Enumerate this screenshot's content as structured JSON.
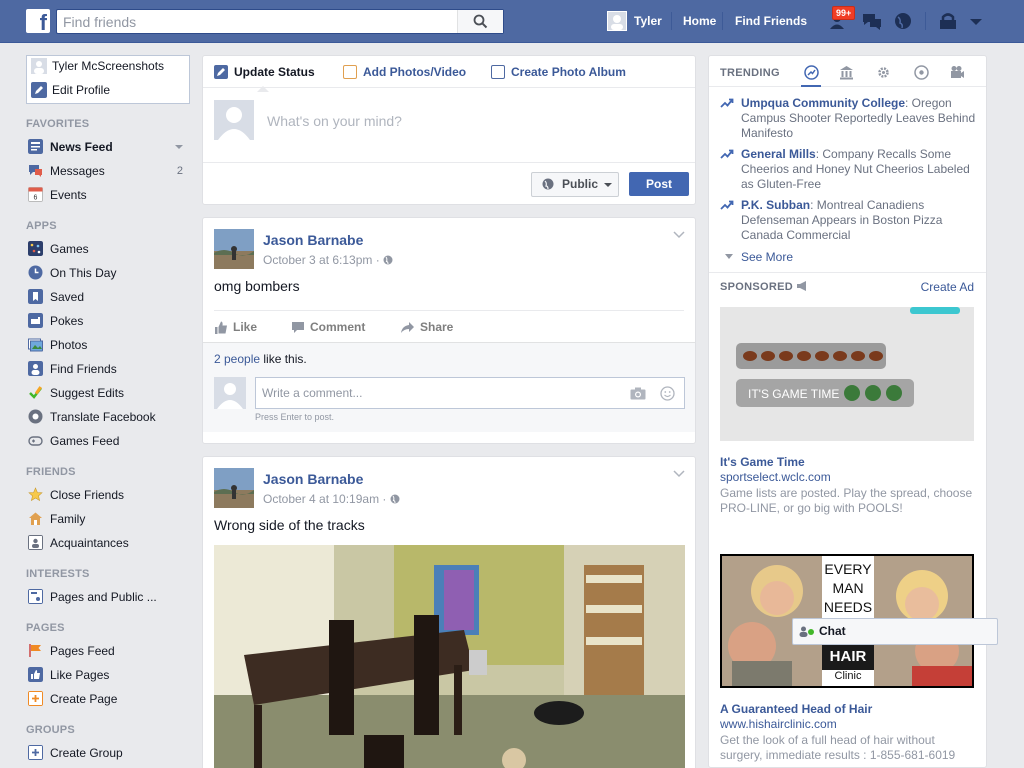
{
  "topbar": {
    "search_placeholder": "Find friends",
    "user_name": "Tyler",
    "home": "Home",
    "find_friends": "Find Friends",
    "notif_count": "99+",
    "brand_color": "#4e69a2"
  },
  "left": {
    "profile_name": "Tyler McScreenshots",
    "edit_profile": "Edit Profile",
    "favorites_title": "FAVORITES",
    "favorites": [
      {
        "label": "News Feed"
      },
      {
        "label": "Messages",
        "count": "2"
      },
      {
        "label": "Events"
      }
    ],
    "apps_title": "APPS",
    "apps": [
      "Games",
      "On This Day",
      "Saved",
      "Pokes",
      "Photos",
      "Find Friends",
      "Suggest Edits",
      "Translate Facebook",
      "Games Feed"
    ],
    "friends_title": "FRIENDS",
    "friends": [
      "Close Friends",
      "Family",
      "Acquaintances"
    ],
    "interests_title": "INTERESTS",
    "interests": [
      "Pages and Public ..."
    ],
    "pages_title": "PAGES",
    "pages": [
      "Pages Feed",
      "Like Pages",
      "Create Page"
    ],
    "groups_title": "GROUPS",
    "groups": [
      "Create Group"
    ]
  },
  "composer": {
    "tab_update": "Update Status",
    "tab_photos": "Add Photos/Video",
    "tab_album": "Create Photo Album",
    "placeholder": "What's on your mind?",
    "privacy": "Public",
    "post_button": "Post"
  },
  "posts": [
    {
      "author": "Jason Barnabe",
      "time": "October 3 at 6:13pm · ",
      "text": "omg bombers",
      "like": "Like",
      "comment": "Comment",
      "share": "Share",
      "likes_link": "2 people",
      "likes_rest": " like this.",
      "comment_placeholder": "Write a comment...",
      "comment_hint": "Press Enter to post."
    },
    {
      "author": "Jason Barnabe",
      "time": "October 4 at 10:19am · ",
      "text": "Wrong side of the tracks"
    }
  ],
  "trending": {
    "title": "TRENDING",
    "items": [
      {
        "topic": "Umpqua Community College",
        "desc": ": Oregon Campus Shooter Reportedly Leaves Behind Manifesto"
      },
      {
        "topic": "General Mills",
        "desc": ": Company Recalls Some Cheerios and Honey Nut Cheerios Labeled as Gluten-Free"
      },
      {
        "topic": "P.K. Subban",
        "desc": ": Montreal Canadiens Defenseman Appears in Boston Pizza Canada Commercial"
      }
    ],
    "see_more": "See More"
  },
  "sponsored": {
    "title": "SPONSORED",
    "create_ad": "Create Ad",
    "ads": [
      {
        "image_text": "IT'S GAME TIME",
        "title": "It's Game Time",
        "url": "sportselect.wclc.com",
        "desc": "Game lists are posted. Play the spread, choose PRO-LINE, or go big with POOLS!"
      },
      {
        "image_text_1": "EVERY",
        "image_text_2": "MAN",
        "image_text_3": "NEEDS",
        "image_text_4": "HAIR",
        "image_text_5": "Clinic",
        "title": "A Guaranteed Head of Hair",
        "url": "www.hishairclinic.com",
        "desc": "Get the look of a full head of hair without surgery, immediate results : 1-855-681-6019"
      }
    ]
  },
  "chat": {
    "label": "Chat"
  }
}
